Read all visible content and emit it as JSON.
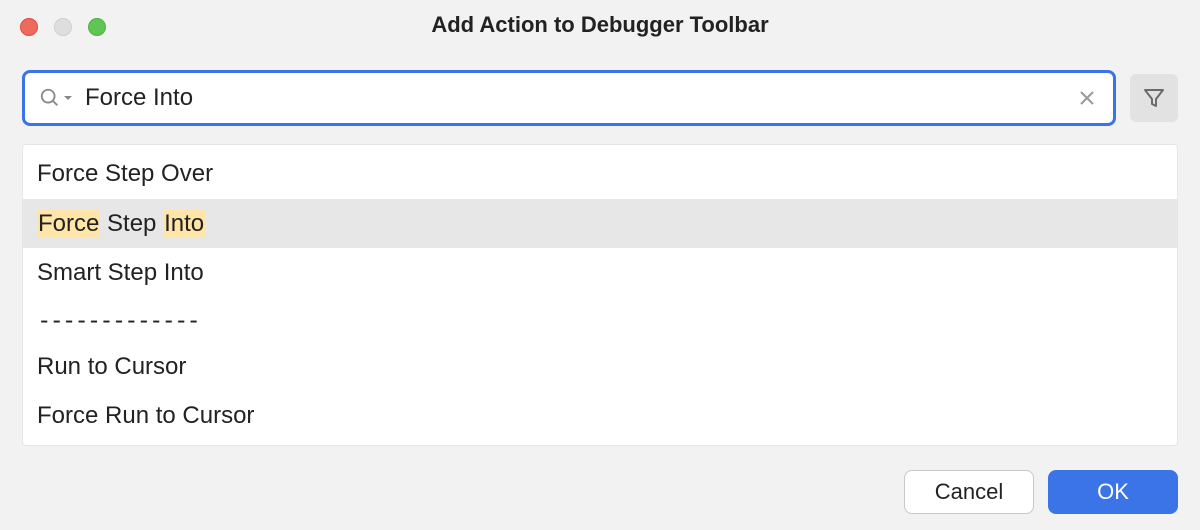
{
  "window": {
    "title": "Add Action to Debugger Toolbar"
  },
  "search": {
    "value": "Force Into",
    "placeholder": ""
  },
  "results": {
    "items": [
      {
        "label": "Force Step Over",
        "selected": false,
        "highlights": []
      },
      {
        "label": "Force Step Into",
        "selected": true,
        "highlights": [
          "Force",
          "Into"
        ]
      },
      {
        "label": "Smart Step Into",
        "selected": false,
        "highlights": []
      }
    ],
    "separator": "-------------",
    "items_after": [
      {
        "label": "Run to Cursor",
        "selected": false
      },
      {
        "label": "Force Run to Cursor",
        "selected": false
      }
    ]
  },
  "buttons": {
    "cancel": "Cancel",
    "ok": "OK"
  }
}
